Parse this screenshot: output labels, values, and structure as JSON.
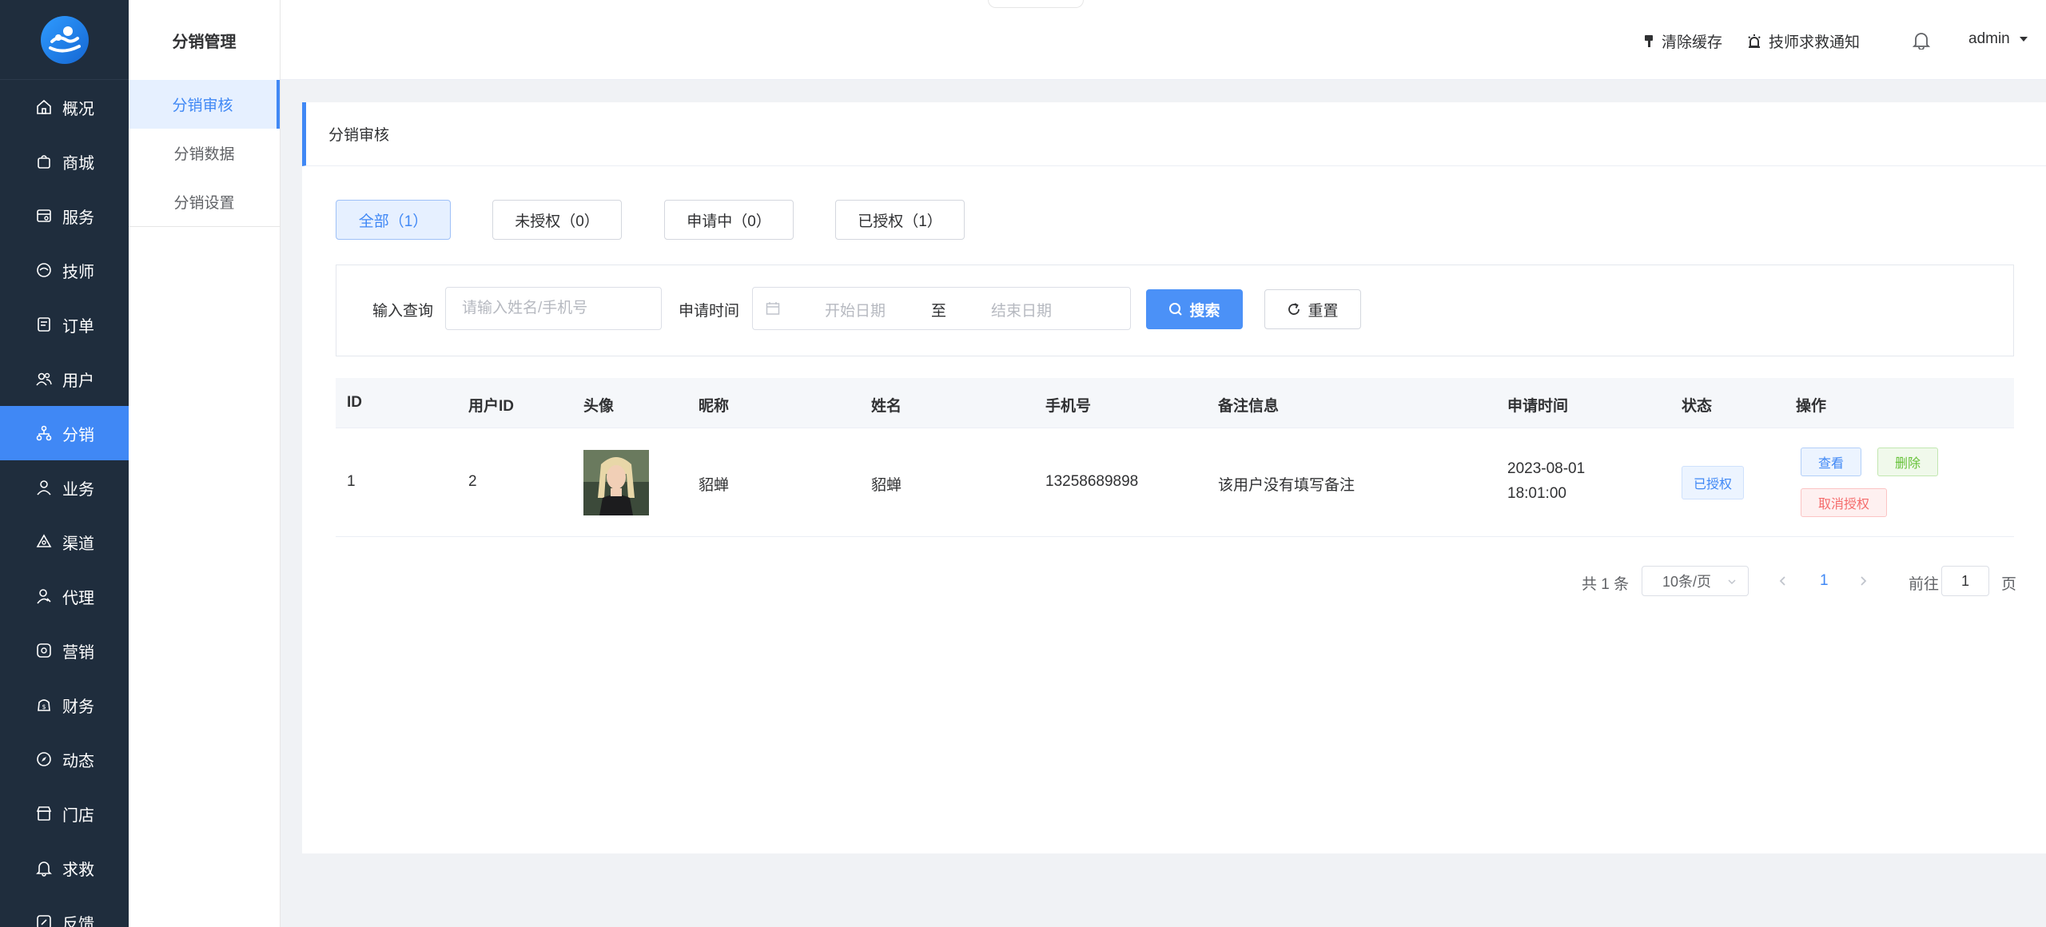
{
  "sidebar": {
    "logo_icon": "mascot-logo-icon",
    "items": [
      {
        "label": "概况",
        "icon": "home-icon"
      },
      {
        "label": "商城",
        "icon": "shopping-bag-icon"
      },
      {
        "label": "服务",
        "icon": "service-icon"
      },
      {
        "label": "技师",
        "icon": "technician-icon"
      },
      {
        "label": "订单",
        "icon": "order-icon"
      },
      {
        "label": "用户",
        "icon": "users-icon"
      },
      {
        "label": "分销",
        "icon": "distribution-icon",
        "active": true
      },
      {
        "label": "业务",
        "icon": "business-icon"
      },
      {
        "label": "渠道",
        "icon": "channel-icon"
      },
      {
        "label": "代理",
        "icon": "agent-icon"
      },
      {
        "label": "营销",
        "icon": "marketing-icon"
      },
      {
        "label": "财务",
        "icon": "finance-icon"
      },
      {
        "label": "动态",
        "icon": "compass-icon"
      },
      {
        "label": "门店",
        "icon": "store-icon"
      },
      {
        "label": "求救",
        "icon": "bell-icon"
      },
      {
        "label": "反馈",
        "icon": "feedback-icon"
      }
    ]
  },
  "subnav": {
    "title": "分销管理",
    "items": [
      {
        "label": "分销审核",
        "active": true
      },
      {
        "label": "分销数据"
      },
      {
        "label": "分销设置"
      }
    ]
  },
  "header": {
    "clear_cache": "清除缓存",
    "sos_notice": "技师求救通知",
    "user": "admin"
  },
  "page": {
    "title": "分销审核",
    "tabs": [
      {
        "label": "全部（1）",
        "active": true
      },
      {
        "label": "未授权（0）"
      },
      {
        "label": "申请中（0）"
      },
      {
        "label": "已授权（1）"
      }
    ],
    "filter": {
      "query_label": "输入查询",
      "query_placeholder": "请输入姓名/手机号",
      "date_label": "申请时间",
      "start_placeholder": "开始日期",
      "range_sep": "至",
      "end_placeholder": "结束日期",
      "search": "搜索",
      "reset": "重置"
    },
    "table": {
      "columns": [
        "ID",
        "用户ID",
        "头像",
        "昵称",
        "姓名",
        "手机号",
        "备注信息",
        "申请时间",
        "状态",
        "操作"
      ],
      "rows": [
        {
          "id": "1",
          "user_id": "2",
          "nickname": "貂蝉",
          "name": "貂蝉",
          "phone": "13258689898",
          "remark": "该用户没有填写备注",
          "date": "2023-08-01",
          "time": "18:01:00",
          "status": "已授权",
          "actions": {
            "view": "查看",
            "delete": "删除",
            "revoke": "取消授权"
          }
        }
      ]
    },
    "pagination": {
      "total": "共 1 条",
      "page_size": "10条/页",
      "current": "1",
      "goto_label": "前往",
      "goto_value": "1",
      "page_unit": "页"
    }
  },
  "colors": {
    "primary": "#4088f5",
    "sidebar_bg": "#1f2d3d",
    "success": "#67c23a",
    "danger": "#f56c6c"
  }
}
